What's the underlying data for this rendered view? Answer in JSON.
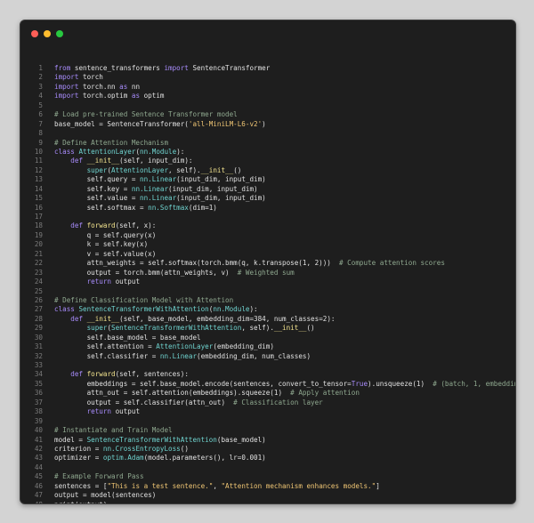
{
  "colors": {
    "close": "#ff5f57",
    "minimize": "#febc2e",
    "maximize": "#28c840",
    "background": "#1e1e1e"
  },
  "lines": [
    {
      "n": "1",
      "t": [
        [
          "kw",
          "from"
        ],
        [
          "pl",
          " sentence_transformers "
        ],
        [
          "kw",
          "import"
        ],
        [
          "pl",
          " SentenceTransformer"
        ]
      ]
    },
    {
      "n": "2",
      "t": [
        [
          "kw",
          "import"
        ],
        [
          "pl",
          " torch"
        ]
      ]
    },
    {
      "n": "3",
      "t": [
        [
          "kw",
          "import"
        ],
        [
          "pl",
          " torch.nn "
        ],
        [
          "kw",
          "as"
        ],
        [
          "pl",
          " nn"
        ]
      ]
    },
    {
      "n": "4",
      "t": [
        [
          "kw",
          "import"
        ],
        [
          "pl",
          " torch.optim "
        ],
        [
          "kw",
          "as"
        ],
        [
          "pl",
          " optim"
        ]
      ]
    },
    {
      "n": "5",
      "t": []
    },
    {
      "n": "6",
      "t": [
        [
          "cm",
          "# Load pre-trained Sentence Transformer model"
        ]
      ]
    },
    {
      "n": "7",
      "t": [
        [
          "pl",
          "base_model = SentenceTransformer("
        ],
        [
          "st",
          "'all-MiniLM-L6-v2'"
        ],
        [
          "pl",
          ")"
        ]
      ]
    },
    {
      "n": "8",
      "t": []
    },
    {
      "n": "9",
      "t": [
        [
          "cm",
          "# Define Attention Mechanism"
        ]
      ]
    },
    {
      "n": "10",
      "t": [
        [
          "kw",
          "class"
        ],
        [
          "pl",
          " "
        ],
        [
          "cl",
          "AttentionLayer"
        ],
        [
          "pl",
          "("
        ],
        [
          "cl",
          "nn.Module"
        ],
        [
          "pl",
          "):"
        ]
      ]
    },
    {
      "n": "11",
      "t": [
        [
          "pl",
          "    "
        ],
        [
          "kw",
          "def"
        ],
        [
          "pl",
          " "
        ],
        [
          "fn",
          "__init__"
        ],
        [
          "pl",
          "(self, input_dim):"
        ]
      ]
    },
    {
      "n": "12",
      "t": [
        [
          "pl",
          "        "
        ],
        [
          "cl",
          "super"
        ],
        [
          "pl",
          "("
        ],
        [
          "cl",
          "AttentionLayer"
        ],
        [
          "pl",
          ", self)."
        ],
        [
          "fn",
          "__init__"
        ],
        [
          "pl",
          "()"
        ]
      ]
    },
    {
      "n": "13",
      "t": [
        [
          "pl",
          "        self.query = "
        ],
        [
          "cl",
          "nn.Linear"
        ],
        [
          "pl",
          "(input_dim, input_dim)"
        ]
      ]
    },
    {
      "n": "14",
      "t": [
        [
          "pl",
          "        self.key = "
        ],
        [
          "cl",
          "nn.Linear"
        ],
        [
          "pl",
          "(input_dim, input_dim)"
        ]
      ]
    },
    {
      "n": "15",
      "t": [
        [
          "pl",
          "        self.value = "
        ],
        [
          "cl",
          "nn.Linear"
        ],
        [
          "pl",
          "(input_dim, input_dim)"
        ]
      ]
    },
    {
      "n": "16",
      "t": [
        [
          "pl",
          "        self.softmax = "
        ],
        [
          "cl",
          "nn.Softmax"
        ],
        [
          "pl",
          "(dim=1)"
        ]
      ]
    },
    {
      "n": "17",
      "t": []
    },
    {
      "n": "18",
      "t": [
        [
          "pl",
          "    "
        ],
        [
          "kw",
          "def"
        ],
        [
          "pl",
          " "
        ],
        [
          "fn",
          "forward"
        ],
        [
          "pl",
          "(self, x):"
        ]
      ]
    },
    {
      "n": "19",
      "t": [
        [
          "pl",
          "        q = self.query(x)"
        ]
      ]
    },
    {
      "n": "20",
      "t": [
        [
          "pl",
          "        k = self.key(x)"
        ]
      ]
    },
    {
      "n": "21",
      "t": [
        [
          "pl",
          "        v = self.value(x)"
        ]
      ]
    },
    {
      "n": "22",
      "t": [
        [
          "pl",
          "        attn_weights = self.softmax(torch.bmm(q, k.transpose(1, 2)))  "
        ],
        [
          "cm",
          "# Compute attention scores"
        ]
      ]
    },
    {
      "n": "23",
      "t": [
        [
          "pl",
          "        output = torch.bmm(attn_weights, v)  "
        ],
        [
          "cm",
          "# Weighted sum"
        ]
      ]
    },
    {
      "n": "24",
      "t": [
        [
          "pl",
          "        "
        ],
        [
          "kw",
          "return"
        ],
        [
          "pl",
          " output"
        ]
      ]
    },
    {
      "n": "25",
      "t": []
    },
    {
      "n": "26",
      "t": [
        [
          "cm",
          "# Define Classification Model with Attention"
        ]
      ]
    },
    {
      "n": "27",
      "t": [
        [
          "kw",
          "class"
        ],
        [
          "pl",
          " "
        ],
        [
          "cl",
          "SentenceTransformerWithAttention"
        ],
        [
          "pl",
          "("
        ],
        [
          "cl",
          "nn.Module"
        ],
        [
          "pl",
          "):"
        ]
      ]
    },
    {
      "n": "28",
      "t": [
        [
          "pl",
          "    "
        ],
        [
          "kw",
          "def"
        ],
        [
          "pl",
          " "
        ],
        [
          "fn",
          "__init__"
        ],
        [
          "pl",
          "(self, base_model, embedding_dim=384, num_classes=2):"
        ]
      ]
    },
    {
      "n": "29",
      "t": [
        [
          "pl",
          "        "
        ],
        [
          "cl",
          "super"
        ],
        [
          "pl",
          "("
        ],
        [
          "cl",
          "SentenceTransformerWithAttention"
        ],
        [
          "pl",
          ", self)."
        ],
        [
          "fn",
          "__init__"
        ],
        [
          "pl",
          "()"
        ]
      ]
    },
    {
      "n": "30",
      "t": [
        [
          "pl",
          "        self.base_model = base_model"
        ]
      ]
    },
    {
      "n": "31",
      "t": [
        [
          "pl",
          "        self.attention = "
        ],
        [
          "cl",
          "AttentionLayer"
        ],
        [
          "pl",
          "(embedding_dim)"
        ]
      ]
    },
    {
      "n": "32",
      "t": [
        [
          "pl",
          "        self.classifier = "
        ],
        [
          "cl",
          "nn.Linear"
        ],
        [
          "pl",
          "(embedding_dim, num_classes)"
        ]
      ]
    },
    {
      "n": "33",
      "t": []
    },
    {
      "n": "34",
      "t": [
        [
          "pl",
          "    "
        ],
        [
          "kw",
          "def"
        ],
        [
          "pl",
          " "
        ],
        [
          "fn",
          "forward"
        ],
        [
          "pl",
          "(self, sentences):"
        ]
      ]
    },
    {
      "n": "35",
      "t": [
        [
          "pl",
          "        embeddings = self.base_model.encode(sentences, convert_to_tensor="
        ],
        [
          "kw",
          "True"
        ],
        [
          "pl",
          ").unsqueeze(1)  "
        ],
        [
          "cm",
          "# (batch, 1, embedding_dim)"
        ]
      ]
    },
    {
      "n": "36",
      "t": [
        [
          "pl",
          "        attn_out = self.attention(embeddings).squeeze(1)  "
        ],
        [
          "cm",
          "# Apply attention"
        ]
      ]
    },
    {
      "n": "37",
      "t": [
        [
          "pl",
          "        output = self.classifier(attn_out)  "
        ],
        [
          "cm",
          "# Classification layer"
        ]
      ]
    },
    {
      "n": "38",
      "t": [
        [
          "pl",
          "        "
        ],
        [
          "kw",
          "return"
        ],
        [
          "pl",
          " output"
        ]
      ]
    },
    {
      "n": "39",
      "t": []
    },
    {
      "n": "40",
      "t": [
        [
          "cm",
          "# Instantiate and Train Model"
        ]
      ]
    },
    {
      "n": "41",
      "t": [
        [
          "pl",
          "model = "
        ],
        [
          "cl",
          "SentenceTransformerWithAttention"
        ],
        [
          "pl",
          "(base_model)"
        ]
      ]
    },
    {
      "n": "42",
      "t": [
        [
          "pl",
          "criterion = "
        ],
        [
          "cl",
          "nn.CrossEntropyLoss"
        ],
        [
          "pl",
          "()"
        ]
      ]
    },
    {
      "n": "43",
      "t": [
        [
          "pl",
          "optimizer = "
        ],
        [
          "cl",
          "optim.Adam"
        ],
        [
          "pl",
          "(model.parameters(), lr=0.001)"
        ]
      ]
    },
    {
      "n": "44",
      "t": []
    },
    {
      "n": "45",
      "t": [
        [
          "cm",
          "# Example Forward Pass"
        ]
      ]
    },
    {
      "n": "46",
      "t": [
        [
          "pl",
          "sentences = ["
        ],
        [
          "st",
          "\"This is a test sentence.\""
        ],
        [
          "pl",
          ", "
        ],
        [
          "st",
          "\"Attention mechanism enhances models.\""
        ],
        [
          "pl",
          "]"
        ]
      ]
    },
    {
      "n": "47",
      "t": [
        [
          "pl",
          "output = model(sentences)"
        ]
      ]
    },
    {
      "n": "48",
      "t": [
        [
          "pl",
          "print(output)"
        ]
      ]
    }
  ]
}
